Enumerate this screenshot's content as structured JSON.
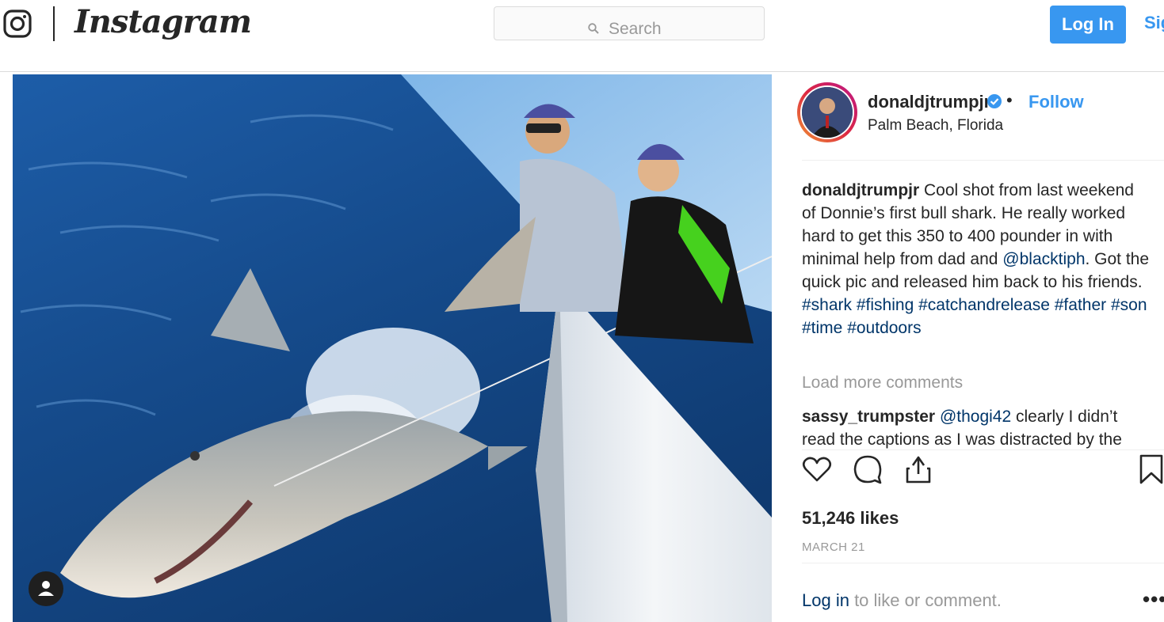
{
  "header": {
    "brand": "Instagram",
    "search_placeholder": "Search",
    "login_label": "Log In",
    "signup_label": "Sign Up"
  },
  "post": {
    "username": "donaldjtrumpjr",
    "follow_label": "Follow",
    "location": "Palm Beach, Florida",
    "caption": {
      "username": "donaldjtrumpjr",
      "text_1": " Cool shot from last weekend of Donnie’s first bull shark. He really worked hard to get this 350 to 400 pounder in with minimal help from dad and ",
      "mention": "@blacktiph",
      "text_2": ". Got the quick pic and released him back to his friends. ",
      "hashtags": [
        "#shark",
        "#fishing",
        "#catchandrelease",
        "#father",
        "#son",
        "#time",
        "#outdoors"
      ]
    },
    "load_more_label": "Load more comments",
    "comments": [
      {
        "username": "sassy_trumpster",
        "mention": "@thogi42",
        "text": " clearly I didn’t read the captions as I was distracted by the"
      }
    ],
    "likes": "51,246 likes",
    "date": "MARCH 21",
    "login_prompt": {
      "link": "Log in",
      "text": " to like or comment."
    },
    "more_label": "•••"
  },
  "colors": {
    "accent": "#3897f0",
    "link": "#003569",
    "muted": "#999999",
    "border": "#dbdbdb"
  },
  "icons": [
    "instagram-glyph-icon",
    "search-icon",
    "verified-icon",
    "heart-icon",
    "comment-icon",
    "share-icon",
    "bookmark-icon",
    "user-tag-icon"
  ]
}
